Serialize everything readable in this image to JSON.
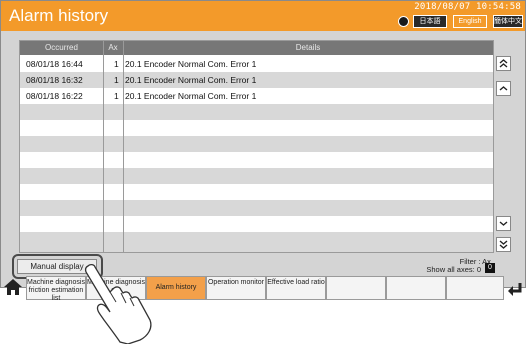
{
  "header": {
    "title": "Alarm history",
    "clock": "2018/08/07  10:54:58",
    "languages": [
      "日本語",
      "English",
      "簡体中文"
    ]
  },
  "table": {
    "columns": [
      "Occurred",
      "Ax",
      "Details"
    ],
    "rows": [
      {
        "occurred": "08/01/18 16:44",
        "axis": "1",
        "details": "20.1 Encoder Normal Com. Error 1"
      },
      {
        "occurred": "08/01/18 16:32",
        "axis": "1",
        "details": "20.1 Encoder Normal Com. Error 1"
      },
      {
        "occurred": "08/01/18 16:22",
        "axis": "1",
        "details": "20.1 Encoder Normal Com. Error 1"
      }
    ]
  },
  "scroll": {
    "top_icon": "double-chevron-up-icon",
    "up_icon": "chevron-up-icon",
    "down_icon": "chevron-down-icon",
    "bottom_icon": "double-chevron-down-icon"
  },
  "manual_display": "Manual display",
  "filter": {
    "line1": "Filter : Ax.",
    "line2": "Show all axes: 0",
    "value": "0"
  },
  "tabs": [
    {
      "label": "Machine diagnosis friction estimation list"
    },
    {
      "label": "Machine diagnosis e..."
    },
    {
      "label": "Alarm history",
      "active": true
    },
    {
      "label": "Operation monitor"
    },
    {
      "label": "Effective load ratio"
    },
    {
      "label": ""
    },
    {
      "label": ""
    },
    {
      "label": ""
    }
  ],
  "colors": {
    "header_bg": "#f39a2a",
    "active_tab": "#f3a04a",
    "table_header": "#777777"
  }
}
